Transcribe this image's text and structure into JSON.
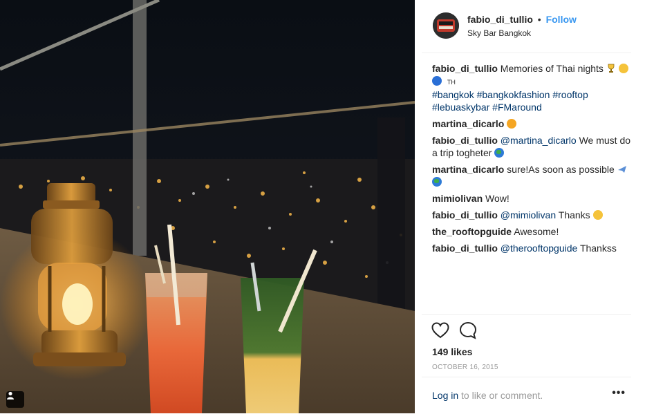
{
  "post": {
    "username": "fabio_di_tullio",
    "separator": "•",
    "follow_label": "Follow",
    "location": "Sky Bar Bangkok",
    "caption": {
      "author": "fabio_di_tullio",
      "text": "Memories of Thai nights",
      "country_code": "TH",
      "hashtags_line1": "#bangkok #bangkokfashion #rooftop",
      "hashtags_line2": "#lebuaskybar #FMaround"
    },
    "comments": [
      {
        "author": "martina_dicarlo",
        "mention": "",
        "text": ""
      },
      {
        "author": "fabio_di_tullio",
        "mention": "@martina_dicarlo",
        "text": "We must do a trip togheter"
      },
      {
        "author": "martina_dicarlo",
        "mention": "",
        "text": "sure!As soon as possible"
      },
      {
        "author": "mimiolivan",
        "mention": "",
        "text": "Wow!"
      },
      {
        "author": "fabio_di_tullio",
        "mention": "@mimiolivan",
        "text": "Thanks"
      },
      {
        "author": "the_rooftopguide",
        "mention": "",
        "text": "Awesome!"
      },
      {
        "author": "fabio_di_tullio",
        "mention": "@therooftopguide",
        "text": "Thankss"
      }
    ],
    "likes": "149 likes",
    "date": "OCTOBER 16, 2015",
    "login_link": "Log in",
    "login_text": "to like or comment.",
    "more_label": "•••"
  },
  "icons": {
    "like": "heart-icon",
    "comment": "comment-icon",
    "tag": "user-tag-icon",
    "more": "more-options-icon"
  },
  "colors": {
    "link_blue": "#3897f0",
    "hashtag_navy": "#003569",
    "muted": "#999999",
    "text": "#262626"
  }
}
